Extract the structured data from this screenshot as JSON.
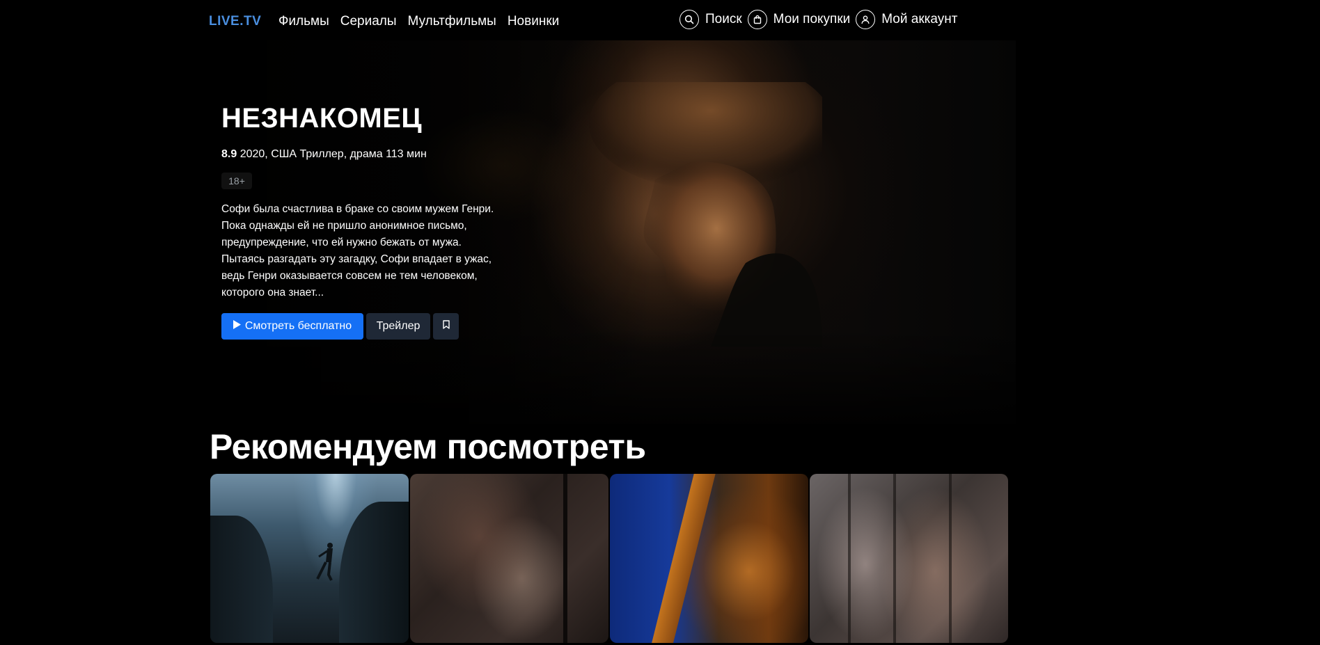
{
  "header": {
    "logo": "LIVE.TV",
    "nav": [
      "Фильмы",
      "Сериалы",
      "Мультфильмы",
      "Новинки"
    ],
    "actions": {
      "search": {
        "label": "Поиск",
        "icon": "search-icon"
      },
      "purchases": {
        "label": "Мои покупки",
        "icon": "shopping-bag-icon"
      },
      "account": {
        "label": "Мой аккаунт",
        "icon": "user-icon"
      }
    }
  },
  "hero": {
    "title": "НЕЗНАКОМЕЦ",
    "rating": "8.9",
    "meta": "2020, США Триллер, драма 113 мин",
    "age": "18+",
    "description": "Софи была счастлива в браке со своим мужем Генри. Пока однажды ей не пришло анонимное письмо, предупреждение, что ей нужно бежать от мужа. Пытаясь разгадать эту загадку, Софи впадает в ужас, ведь Генри оказывается совсем не тем человеком, которого она знает...",
    "buttons": {
      "watch": "Смотреть бесплатно",
      "trailer": "Трейлер"
    }
  },
  "recommended": {
    "title": "Рекомендуем посмотреть"
  },
  "colors": {
    "accent": "#1570f5",
    "logo": "#4a8fe0",
    "secondary_button": "#1f2836",
    "background": "#000000"
  }
}
